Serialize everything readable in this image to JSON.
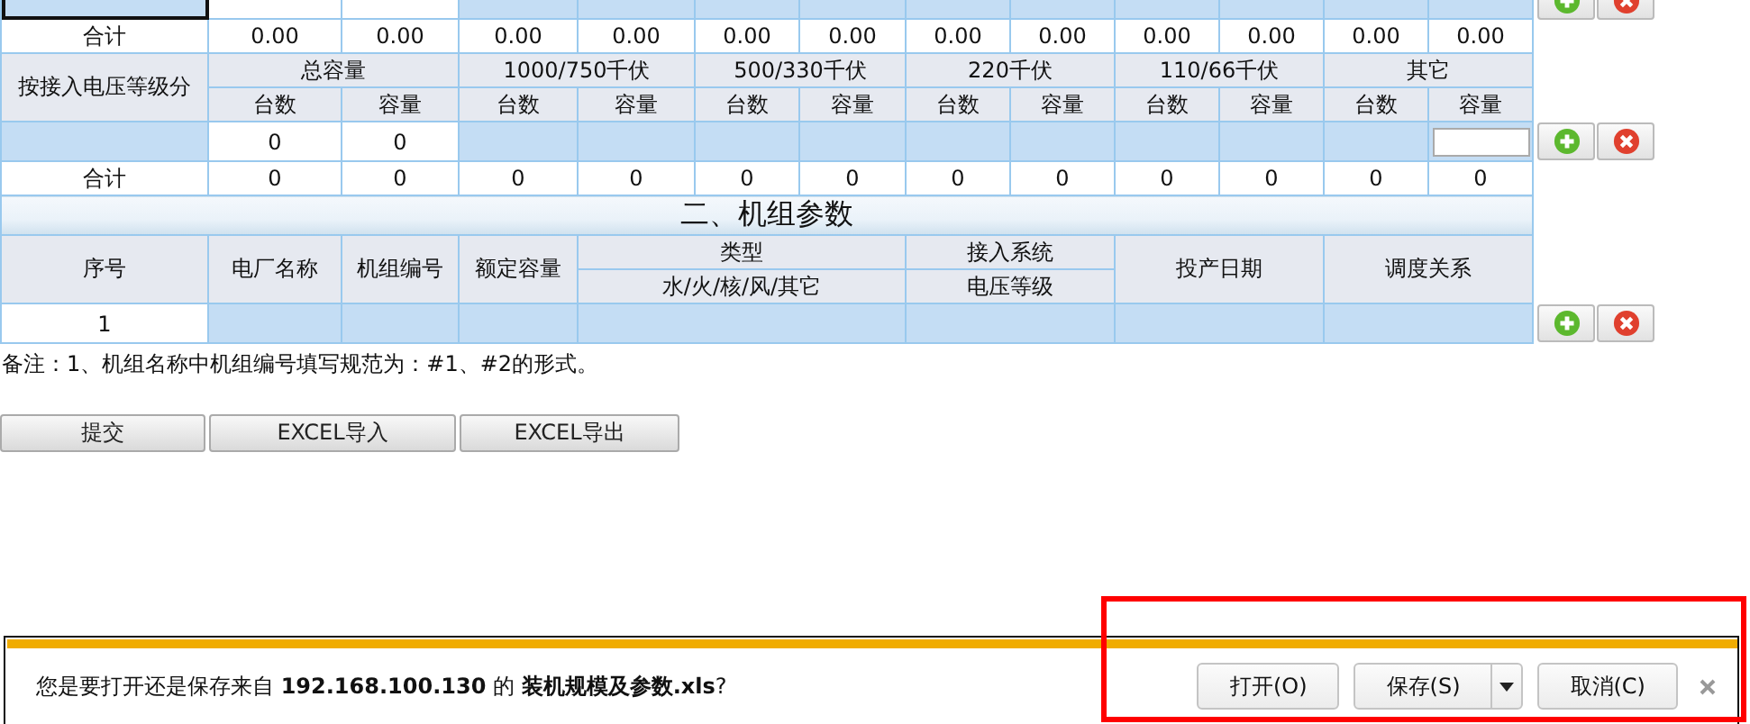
{
  "capacity_table": {
    "partial_row": {
      "actions": [
        {
          "kind": "add"
        },
        {
          "kind": "delete"
        }
      ],
      "cells": [
        {
          "kind": "entry",
          "selected": true
        },
        {
          "kind": "blank",
          "selected": false
        },
        {
          "kind": "blank",
          "selected": false
        },
        {
          "kind": "entry",
          "selected": false
        },
        {
          "kind": "entry",
          "selected": false
        },
        {
          "kind": "entry",
          "selected": false
        },
        {
          "kind": "entry",
          "selected": false
        },
        {
          "kind": "entry",
          "selected": false
        },
        {
          "kind": "entry",
          "selected": false
        },
        {
          "kind": "entry",
          "selected": false
        },
        {
          "kind": "entry",
          "selected": false
        },
        {
          "kind": "entry",
          "selected": false
        },
        {
          "kind": "entry",
          "selected": false
        }
      ]
    },
    "total_row": {
      "label": "合计",
      "values": [
        "0.00",
        "0.00",
        "0.00",
        "0.00",
        "0.00",
        "0.00",
        "0.00",
        "0.00",
        "0.00",
        "0.00",
        "0.00",
        "0.00"
      ]
    }
  },
  "voltage_table": {
    "row_header": "按接入电压等级分",
    "groups": [
      "总容量",
      "1000/750千伏",
      "500/330千伏",
      "220千伏",
      "110/66千伏",
      "其它"
    ],
    "subheaders": [
      "台数",
      "容量",
      "台数",
      "容量",
      "台数",
      "容量",
      "台数",
      "容量",
      "台数",
      "容量",
      "台数",
      "容量"
    ],
    "entry_row": {
      "actions": [
        {
          "kind": "add"
        },
        {
          "kind": "delete"
        }
      ],
      "cells": [
        {
          "kind": "entry"
        },
        {
          "kind": "value",
          "text": "0"
        },
        {
          "kind": "value",
          "text": "0"
        },
        {
          "kind": "entry"
        },
        {
          "kind": "entry"
        },
        {
          "kind": "entry"
        },
        {
          "kind": "entry"
        },
        {
          "kind": "entry"
        },
        {
          "kind": "entry"
        },
        {
          "kind": "entry"
        },
        {
          "kind": "entry"
        },
        {
          "kind": "entry"
        },
        {
          "kind": "input"
        }
      ]
    },
    "total_row": {
      "label": "合计",
      "values": [
        "0",
        "0",
        "0",
        "0",
        "0",
        "0",
        "0",
        "0",
        "0",
        "0",
        "0",
        "0"
      ]
    }
  },
  "units_section": {
    "title": "二、机组参数",
    "headers": [
      {
        "label": "序号"
      },
      {
        "label": "电厂名称"
      },
      {
        "label": "机组编号"
      },
      {
        "label": "额定容量"
      },
      {
        "label": "类型",
        "sub": "水/火/核/风/其它"
      },
      {
        "label": "接入系统",
        "sub": "电压等级"
      },
      {
        "label": "投产日期"
      },
      {
        "label": "调度关系"
      }
    ],
    "rows": [
      {
        "actions": [
          {
            "kind": "add"
          },
          {
            "kind": "delete"
          }
        ],
        "cells": [
          {
            "kind": "value",
            "text": "1"
          },
          {
            "kind": "entry"
          },
          {
            "kind": "entry"
          },
          {
            "kind": "entry"
          },
          {
            "kind": "entry"
          },
          {
            "kind": "entry"
          },
          {
            "kind": "entry"
          },
          {
            "kind": "entry"
          }
        ]
      }
    ]
  },
  "note": "备注：1、机组名称中机组编号填写规范为：#1、#2的形式。",
  "buttons": [
    "提交",
    "EXCEL导入",
    "EXCEL导出"
  ],
  "download_bar": {
    "message": "您是要打开还是保存来自 **192.168.100.130** 的 **装机规模及参数.xls**?",
    "buttons": [
      {
        "label": "打开(O)",
        "kind": "plain"
      },
      {
        "label": "保存(S)",
        "kind": "split"
      },
      {
        "label": "取消(C)",
        "kind": "plain"
      }
    ]
  },
  "annotation": {
    "kind": "frame"
  }
}
